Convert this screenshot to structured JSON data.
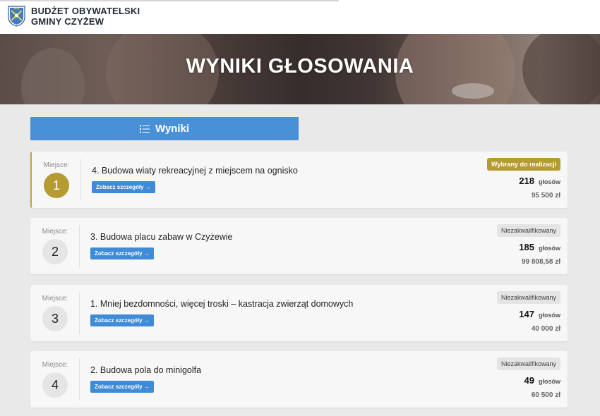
{
  "header": {
    "logo_line1": "BUDŻET OBYWATELSKI",
    "logo_line2": "GMINY CZYŻEW"
  },
  "hero": {
    "title": "WYNIKI GŁOSOWANIA"
  },
  "tab": {
    "label": "Wyniki"
  },
  "colors": {
    "accent_blue": "#4a90d9",
    "gold": "#b59b32",
    "card_bg": "#f7f7f7",
    "page_bg": "#e9e9e9"
  },
  "results": [
    {
      "place_label": "Miejsce:",
      "place": "1",
      "title": "4.  Budowa wiaty rekreacyjnej z miejscem na ognisko",
      "details_label": "Zobacz szczegóły →",
      "status": "Wybrany do realizacji",
      "votes": "218",
      "votes_unit": "głosów",
      "amount": "95 500 zł"
    },
    {
      "place_label": "Miejsce:",
      "place": "2",
      "title": "3.  Budowa placu zabaw w Czyżewie",
      "details_label": "Zobacz szczegóły →",
      "status": "Niezakwalifikowany",
      "votes": "185",
      "votes_unit": "głosów",
      "amount": "99 808,58 zł"
    },
    {
      "place_label": "Miejsce:",
      "place": "3",
      "title": "1.  Mniej bezdomności, więcej troski – kastracja zwierząt domowych",
      "details_label": "Zobacz szczegóły →",
      "status": "Niezakwalifikowany",
      "votes": "147",
      "votes_unit": "głosów",
      "amount": "40 000 zł"
    },
    {
      "place_label": "Miejsce:",
      "place": "4",
      "title": "2.  Budowa pola do minigolfa",
      "details_label": "Zobacz szczegóły →",
      "status": "Niezakwalifikowany",
      "votes": "49",
      "votes_unit": "głosów",
      "amount": "60 500 zł"
    }
  ]
}
